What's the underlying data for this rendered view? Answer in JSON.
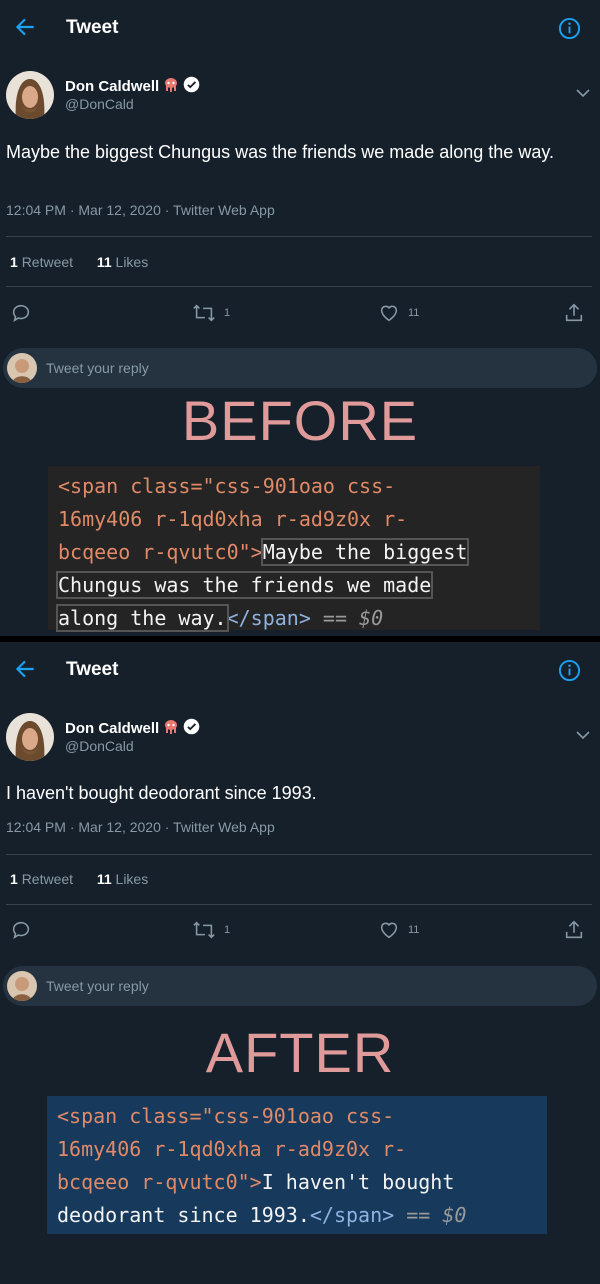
{
  "before": {
    "header": {
      "title": "Tweet"
    },
    "user": {
      "name": "Don Caldwell",
      "handle": "@DonCald"
    },
    "tweet": {
      "text": "Maybe the biggest Chungus was the friends we made along the way.",
      "meta": "12:04 PM · Mar 12, 2020 · Twitter Web App"
    },
    "stats": {
      "retweets": "1",
      "retweets_label": "Retweet",
      "likes": "11",
      "likes_label": "Likes"
    },
    "actions": {
      "retweet_count": "1",
      "like_count": "11"
    },
    "reply": {
      "placeholder": "Tweet your reply"
    },
    "caption": "BEFORE",
    "code": {
      "line1": "<span class=\"css-901oao css-",
      "line2": "16my406 r-1qd0xha r-ad9z0x r-",
      "line3_tag": "bcqeeo r-qvutc0\">",
      "line3_text": "Maybe the biggest",
      "line4": "Chungus was the friends we made",
      "line5_text": "along the way.",
      "line5_close": "</span>",
      "suffix": " == $0"
    }
  },
  "after": {
    "header": {
      "title": "Tweet"
    },
    "user": {
      "name": "Don Caldwell",
      "handle": "@DonCald"
    },
    "tweet": {
      "text": "I haven't bought deodorant since 1993.",
      "meta": "12:04 PM · Mar 12, 2020 · Twitter Web App"
    },
    "stats": {
      "retweets": "1",
      "retweets_label": "Retweet",
      "likes": "11",
      "likes_label": "Likes"
    },
    "actions": {
      "retweet_count": "1",
      "like_count": "11"
    },
    "reply": {
      "placeholder": "Tweet your reply"
    },
    "caption": "AFTER",
    "code": {
      "line1": "<span class=\"css-901oao css-",
      "line2": "16my406 r-1qd0xha r-ad9z0x r-",
      "line3_tag": "bcqeeo r-qvutc0\">",
      "line3_text": "I haven't bought",
      "line4_text": "deodorant since 1993.",
      "line4_close": "</span>",
      "suffix": " == $0"
    }
  },
  "colors": {
    "background": "#15202b",
    "accent": "#1da1f2",
    "muted": "#8899a6",
    "caption": "#e09a9a"
  },
  "icons": [
    "back-arrow-icon",
    "info-icon",
    "alien-emoji-icon",
    "verified-badge-icon",
    "chevron-down-icon",
    "comment-icon",
    "retweet-icon",
    "like-icon",
    "share-icon"
  ]
}
